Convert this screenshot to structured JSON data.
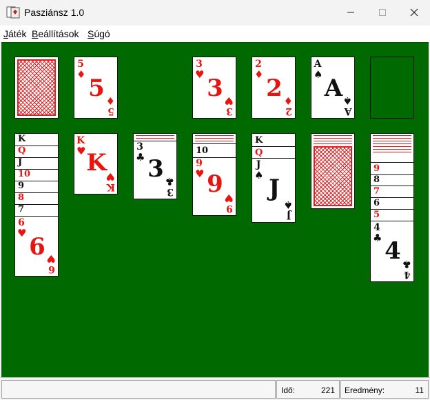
{
  "window": {
    "title": "Pasziánsz 1.0"
  },
  "menu": [
    {
      "mnemonic": "J",
      "rest": "áték"
    },
    {
      "mnemonic": "B",
      "rest": "eállítások"
    },
    {
      "mnemonic": "S",
      "rest": "úgó"
    }
  ],
  "stock": {
    "state": "face-down"
  },
  "waste": {
    "rank": "5",
    "suit": "♦",
    "color": "red"
  },
  "foundations": [
    {
      "rank": "3",
      "suit": "♥",
      "color": "red"
    },
    {
      "rank": "2",
      "suit": "♦",
      "color": "red"
    },
    {
      "rank": "A",
      "suit": "♠",
      "color": "black"
    },
    {
      "rank": "",
      "suit": "",
      "color": ""
    }
  ],
  "tableau": [
    {
      "hidden": 0,
      "fanned": [
        {
          "rank": "K",
          "color": "black"
        },
        {
          "rank": "Q",
          "color": "red"
        },
        {
          "rank": "J",
          "color": "black"
        },
        {
          "rank": "10",
          "color": "red"
        },
        {
          "rank": "9",
          "color": "black"
        },
        {
          "rank": "8",
          "color": "red"
        },
        {
          "rank": "7",
          "color": "black"
        }
      ],
      "top": {
        "rank": "6",
        "suit": "♥",
        "color": "red"
      }
    },
    {
      "hidden": 0,
      "fanned": [],
      "top": {
        "rank": "K",
        "suit": "♥",
        "color": "red"
      }
    },
    {
      "hidden": 2,
      "fanned": [],
      "top": {
        "rank": "3",
        "suit": "♣",
        "color": "black"
      }
    },
    {
      "hidden": 3,
      "fanned": [
        {
          "rank": "10",
          "color": "black"
        }
      ],
      "top": {
        "rank": "9",
        "suit": "♥",
        "color": "red"
      }
    },
    {
      "hidden": 0,
      "fanned": [
        {
          "rank": "K",
          "color": "black"
        },
        {
          "rank": "Q",
          "color": "red"
        }
      ],
      "top": {
        "rank": "J",
        "suit": "♠",
        "color": "black"
      }
    },
    {
      "hidden": 3,
      "fanned": [],
      "top": {
        "state": "face-down"
      }
    },
    {
      "hidden": 6,
      "fanned": [
        {
          "rank": "9",
          "color": "red"
        },
        {
          "rank": "8",
          "color": "black"
        },
        {
          "rank": "7",
          "color": "red"
        },
        {
          "rank": "6",
          "color": "black"
        },
        {
          "rank": "5",
          "color": "red"
        }
      ],
      "top": {
        "rank": "4",
        "suit": "♣",
        "color": "black"
      }
    }
  ],
  "status": {
    "time_label": "Idő:",
    "time_value": "221",
    "score_label": "Eredmény:",
    "score_value": "11"
  },
  "colors": {
    "felt": "#006a00",
    "red": "#e8140f",
    "black": "#111111"
  },
  "icons": [
    "app-icon",
    "minimize-icon",
    "maximize-icon",
    "close-icon"
  ]
}
